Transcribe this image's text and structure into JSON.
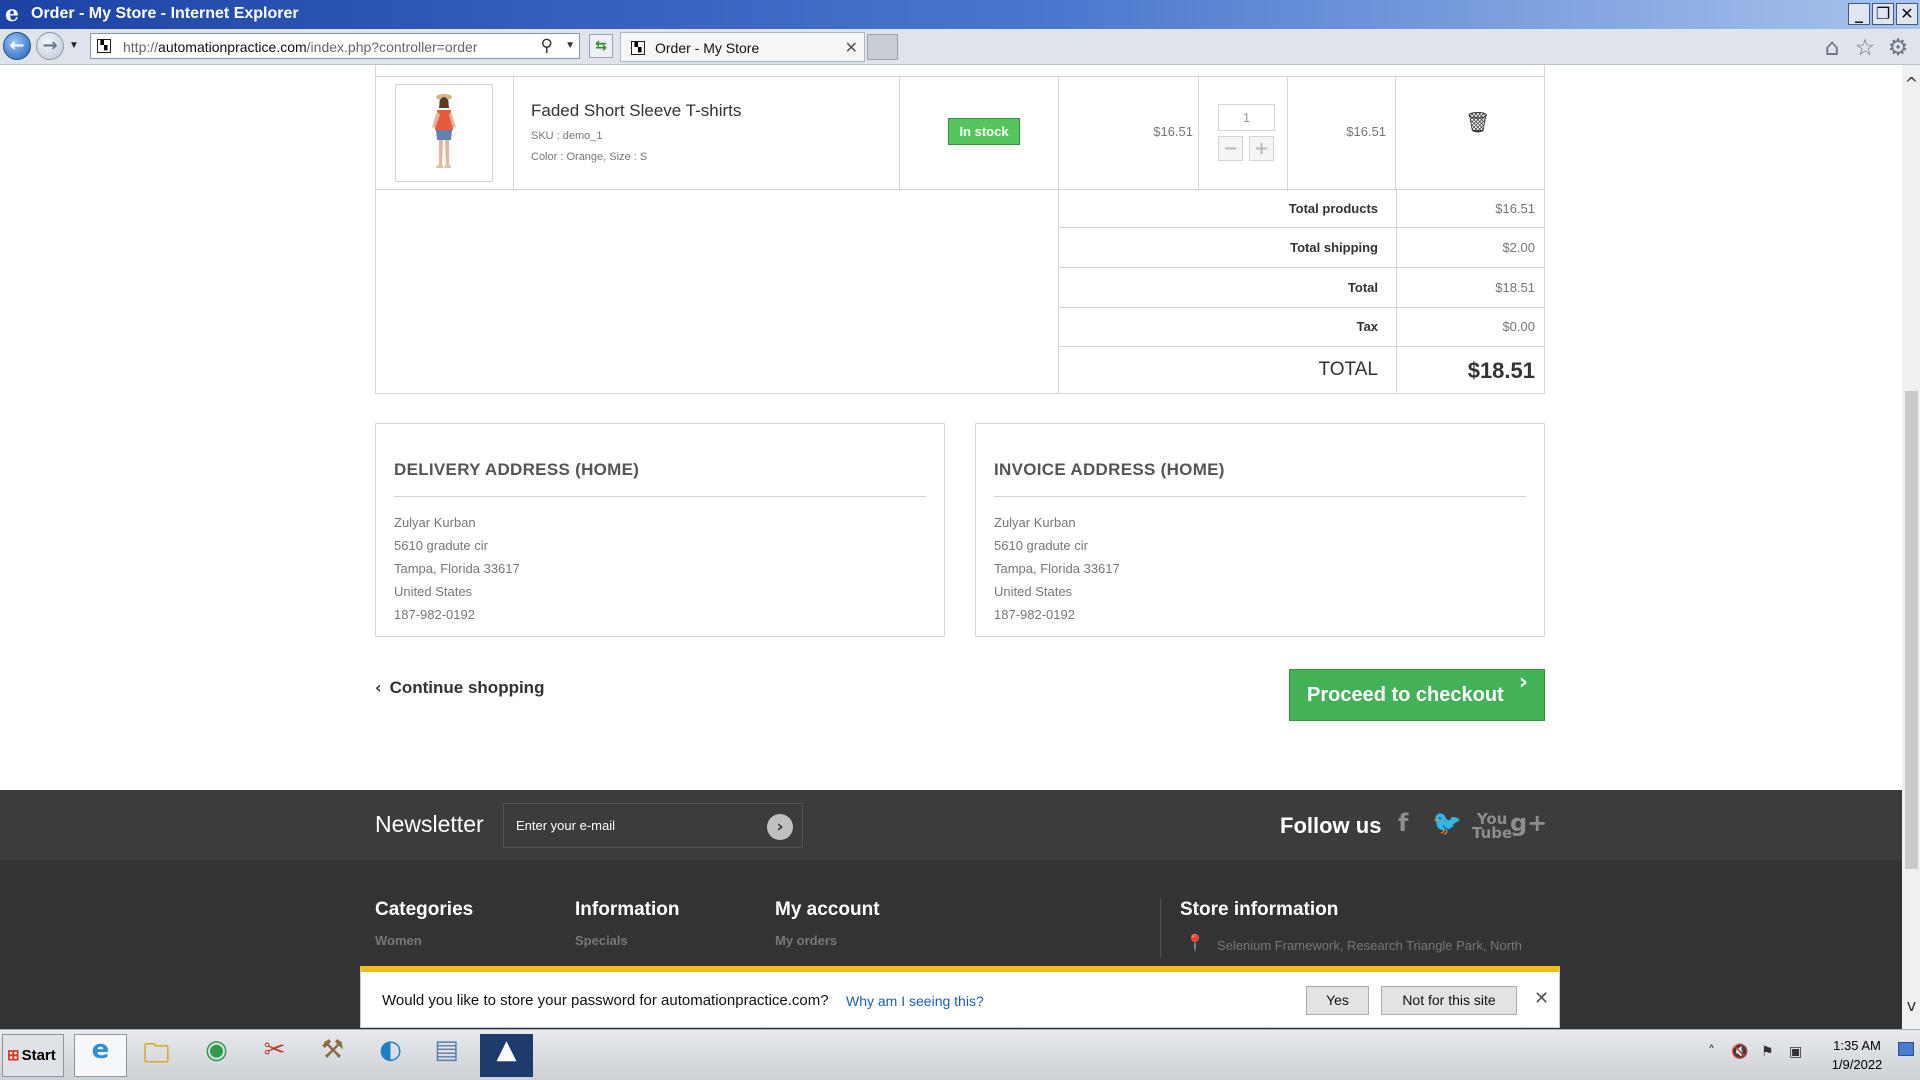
{
  "window": {
    "title": "Order - My Store - Internet Explorer"
  },
  "browser": {
    "url_prefix": "http://",
    "url_domain": "automationpractice.com",
    "url_path": "/index.php?controller=order",
    "tab_label": "Order - My Store"
  },
  "cart": {
    "item": {
      "name": "Faded Short Sleeve T-shirts",
      "sku": "SKU : demo_1",
      "attributes": "Color : Orange, Size : S",
      "availability": "In stock",
      "unit_price": "$16.51",
      "quantity": "1",
      "line_total": "$16.51"
    },
    "totals": [
      {
        "label": "Total products",
        "value": "$16.51"
      },
      {
        "label": "Total shipping",
        "value": "$2.00"
      },
      {
        "label": "Total",
        "value": "$18.51"
      },
      {
        "label": "Tax",
        "value": "$0.00"
      },
      {
        "label": "TOTAL",
        "value": "$18.51"
      }
    ]
  },
  "delivery_address": {
    "title": "DELIVERY ADDRESS (HOME)",
    "lines": [
      "Zulyar Kurban",
      "5610 gradute cir",
      "Tampa, Florida 33617",
      "United States",
      "187-982-0192"
    ]
  },
  "invoice_address": {
    "title": "INVOICE ADDRESS (HOME)",
    "lines": [
      "Zulyar Kurban",
      "5610 gradute cir",
      "Tampa, Florida 33617",
      "United States",
      "187-982-0192"
    ]
  },
  "actions": {
    "continue": "Continue shopping",
    "checkout": "Proceed to checkout"
  },
  "newsletter": {
    "label": "Newsletter",
    "placeholder": "Enter your e-mail",
    "follow": "Follow us"
  },
  "footer": {
    "categories": {
      "title": "Categories",
      "first": "Women"
    },
    "information": {
      "title": "Information",
      "first": "Specials"
    },
    "account": {
      "title": "My account",
      "first": "My orders"
    },
    "store": {
      "title": "Store information",
      "first": "Selenium Framework, Research Triangle Park, North"
    }
  },
  "password_bar": {
    "message": "Would you like to store your password for automationpractice.com?",
    "why": "Why am I seeing this?",
    "yes": "Yes",
    "no": "Not for this site"
  },
  "taskbar": {
    "start": "Start",
    "time": "1:35 AM",
    "date": "1/9/2022"
  },
  "colors": {
    "checkout_green": "#43b155",
    "in_stock_green": "#55c65e",
    "footer_dark": "#333333",
    "password_bar_accent": "#f4bc1a"
  },
  "icons": [
    "search-icon",
    "refresh-icon",
    "home-icon",
    "favorites-star-icon",
    "settings-gear-icon",
    "trash-icon",
    "facebook-icon",
    "twitter-icon",
    "youtube-icon",
    "google-plus-icon",
    "location-pin-icon"
  ]
}
